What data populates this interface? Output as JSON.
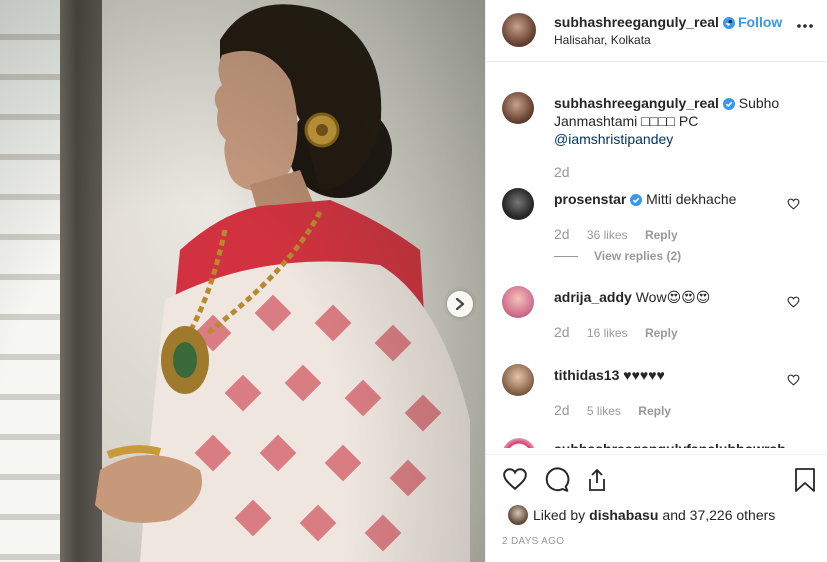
{
  "post": {
    "username": "subhashreeganguly_real",
    "follow_sep": "•",
    "follow_label": "Follow",
    "location": "Halisahar, Kolkata",
    "caption_user": "subhashreeganguly_real",
    "caption_text": "Subho Janmashtami □□□□ PC",
    "caption_mention": "@iamshristipandey",
    "caption_age": "2d",
    "liked_by_prefix": "Liked by",
    "liked_by_user": "dishabasu",
    "liked_by_suffix": "and 37,226 others",
    "date": "2 DAYS AGO"
  },
  "comments": [
    {
      "user": "prosenstar",
      "text": "Mitti dekhache",
      "age": "2d",
      "likes": "36 likes",
      "reply": "Reply",
      "view_replies": "View replies (2)"
    },
    {
      "user": "adrija_addy",
      "text": "Wow😍😍😍",
      "age": "2d",
      "likes": "16 likes",
      "reply": "Reply"
    },
    {
      "user": "tithidas13",
      "text": "♥♥♥♥♥",
      "age": "2d",
      "likes": "5 likes",
      "reply": "Reply"
    },
    {
      "user": "subhashreegangulyfanclubhowrah"
    }
  ],
  "colors": {
    "link": "#3897f0",
    "mention": "#003569",
    "muted": "#999999"
  }
}
